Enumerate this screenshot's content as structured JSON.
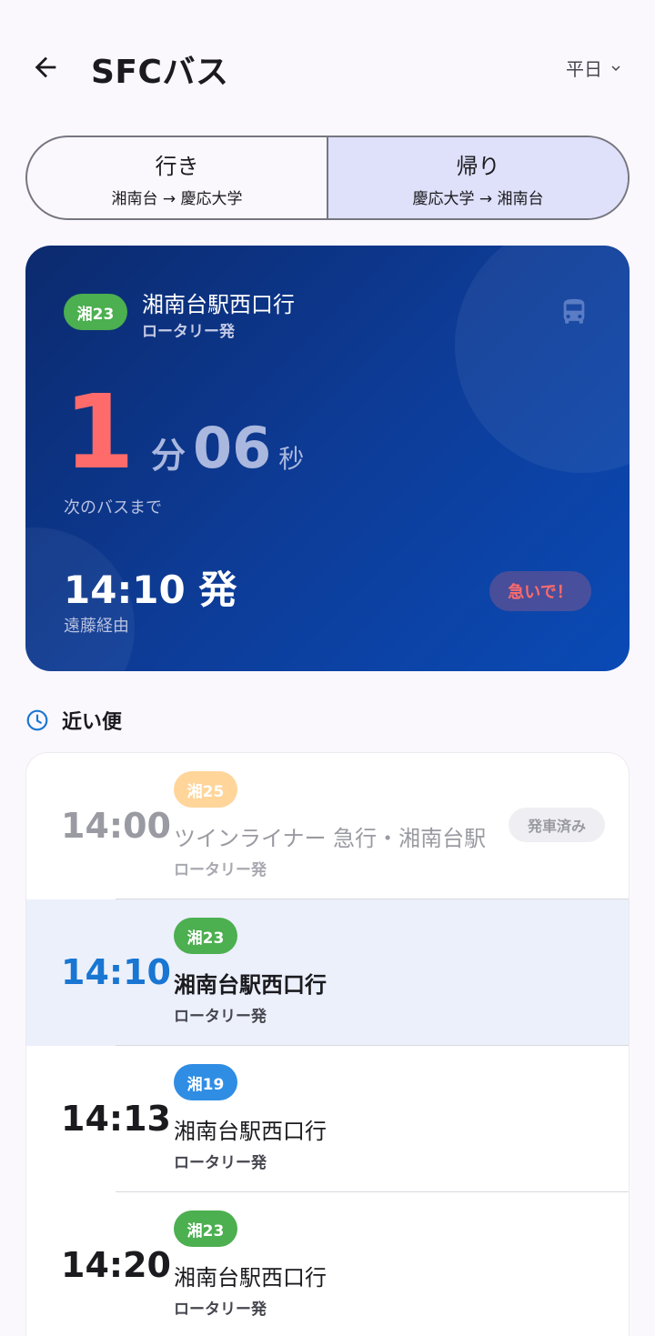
{
  "header": {
    "title": "SFCバス",
    "day": "平日"
  },
  "direction": {
    "outbound": {
      "label": "行き",
      "route": "湘南台 → 慶応大学"
    },
    "inbound": {
      "label": "帰り",
      "route": "慶応大学 → 湘南台"
    }
  },
  "next_bus": {
    "route": "湘23",
    "route_color": "#4caf50",
    "destination": "湘南台駅西口行",
    "origin": "ロータリー発",
    "minutes": "1",
    "minutes_unit": "分",
    "seconds": "06",
    "seconds_unit": "秒",
    "until_label": "次のバスまで",
    "departure": "14:10 発",
    "via": "遠藤経由",
    "hurry": "急いで！"
  },
  "nearby": {
    "title": "近い便",
    "rows": [
      {
        "time": "14:00",
        "route": "湘25",
        "route_color": "#ffd59a",
        "destination": "ツインライナー 急行・湘南台駅",
        "origin": "ロータリー発",
        "status": "発車済み"
      },
      {
        "time": "14:10",
        "route": "湘23",
        "route_color": "#4caf50",
        "destination": "湘南台駅西口行",
        "origin": "ロータリー発"
      },
      {
        "time": "14:13",
        "route": "湘19",
        "route_color": "#2f8de4",
        "destination": "湘南台駅西口行",
        "origin": "ロータリー発"
      },
      {
        "time": "14:20",
        "route": "湘23",
        "route_color": "#4caf50",
        "destination": "湘南台駅西口行",
        "origin": "ロータリー発"
      }
    ]
  },
  "icons": {
    "back": "arrow-back-icon",
    "dropdown": "chevron-down-icon",
    "bus": "bus-icon",
    "clock": "clock-icon"
  }
}
